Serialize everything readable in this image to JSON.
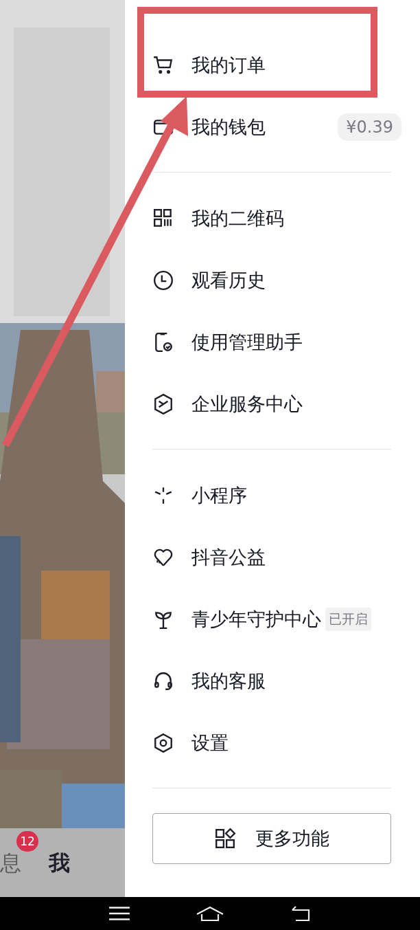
{
  "menu_sections": [
    {
      "items": [
        {
          "label": "我的订单",
          "highlighted": true
        },
        {
          "label": "我的钱包",
          "highlighted": false,
          "value": "¥0.39"
        }
      ]
    },
    {
      "items": [
        {
          "label": "我的二维码",
          "highlighted": false
        },
        {
          "label": "观看历史",
          "highlighted": false
        },
        {
          "label": "使用管理助手",
          "highlighted": false
        },
        {
          "label": "企业服务中心",
          "highlighted": false
        }
      ]
    },
    {
      "items": [
        {
          "label": "小程序",
          "highlighted": false
        },
        {
          "label": "抖音公益",
          "highlighted": false
        },
        {
          "label": "青少年守护中心",
          "highlighted": false,
          "tag": "已开启"
        },
        {
          "label": "我的客服",
          "highlighted": false
        },
        {
          "label": "设置",
          "highlighted": false
        }
      ]
    }
  ],
  "more_button": {
    "label": "更多功能"
  },
  "tab_bar": [
    {
      "label": "息",
      "selected": false,
      "badge": "12"
    },
    {
      "label": "我",
      "selected": true
    }
  ]
}
